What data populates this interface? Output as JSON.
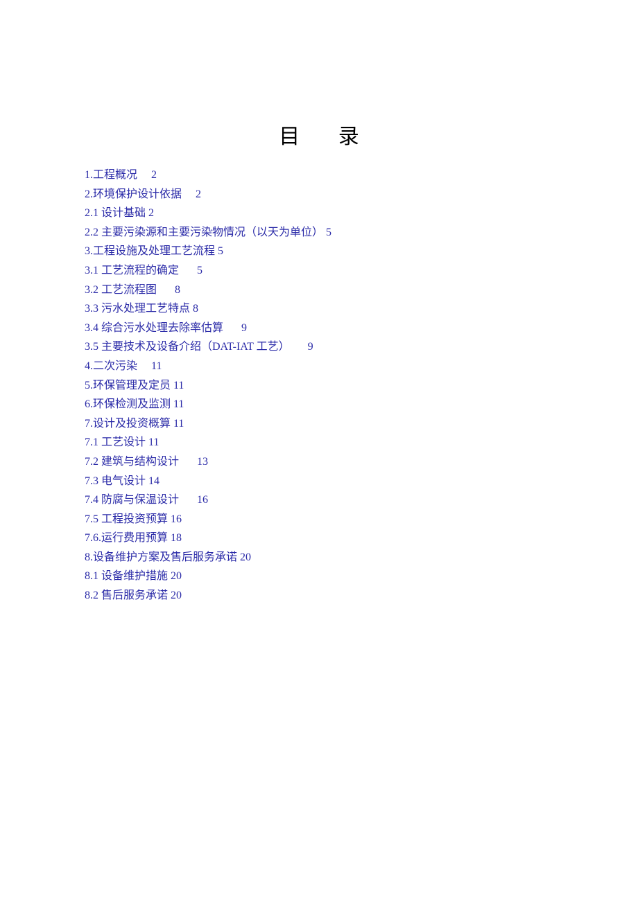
{
  "title": "目 录",
  "entries": [
    {
      "label": "1.工程概况",
      "page": "2",
      "spacer": "sp-sm"
    },
    {
      "label": "2.环境保护设计依据",
      "page": "2",
      "spacer": "sp-sm"
    },
    {
      "label": "2.1 设计基础",
      "page": "2",
      "spacer": "sp-none"
    },
    {
      "label": "2.2 主要污染源和主要污染物情况（以天为单位）",
      "page": "5",
      "spacer": "sp-none"
    },
    {
      "label": "3.工程设施及处理工艺流程",
      "page": "5",
      "spacer": "sp-none"
    },
    {
      "label": "3.1 工艺流程的确定",
      "page": "5",
      "spacer": "sp-md"
    },
    {
      "label": "3.2 工艺流程图",
      "page": "8",
      "spacer": "sp-md"
    },
    {
      "label": "3.3 污水处理工艺特点",
      "page": "8",
      "spacer": "sp-none"
    },
    {
      "label": "3.4 综合污水处理去除率估算",
      "page": "9",
      "spacer": "sp-md"
    },
    {
      "label": "3.5 主要技术及设备介绍（DAT-IAT 工艺）",
      "page": "9",
      "spacer": "sp-md"
    },
    {
      "label": "4.二次污染",
      "page": "11",
      "spacer": "sp-sm"
    },
    {
      "label": "5.环保管理及定员",
      "page": "11",
      "spacer": "sp-none"
    },
    {
      "label": "6.环保检测及监测",
      "page": "11",
      "spacer": "sp-none"
    },
    {
      "label": "7.设计及投资概算",
      "page": "11",
      "spacer": "sp-none"
    },
    {
      "label": "7.1 工艺设计",
      "page": "11",
      "spacer": "sp-none"
    },
    {
      "label": "7.2 建筑与结构设计",
      "page": "13",
      "spacer": "sp-md"
    },
    {
      "label": "7.3 电气设计",
      "page": "14",
      "spacer": "sp-none"
    },
    {
      "label": "7.4 防腐与保温设计",
      "page": "16",
      "spacer": "sp-md"
    },
    {
      "label": "7.5 工程投资预算",
      "page": "16",
      "spacer": "sp-none"
    },
    {
      "label": "7.6.运行费用预算",
      "page": "18",
      "spacer": "sp-none"
    },
    {
      "label": "8.设备维护方案及售后服务承诺",
      "page": "20",
      "spacer": "sp-none"
    },
    {
      "label": "8.1 设备维护措施",
      "page": "20",
      "spacer": "sp-none"
    },
    {
      "label": "8.2 售后服务承诺",
      "page": "20",
      "spacer": "sp-none"
    }
  ]
}
